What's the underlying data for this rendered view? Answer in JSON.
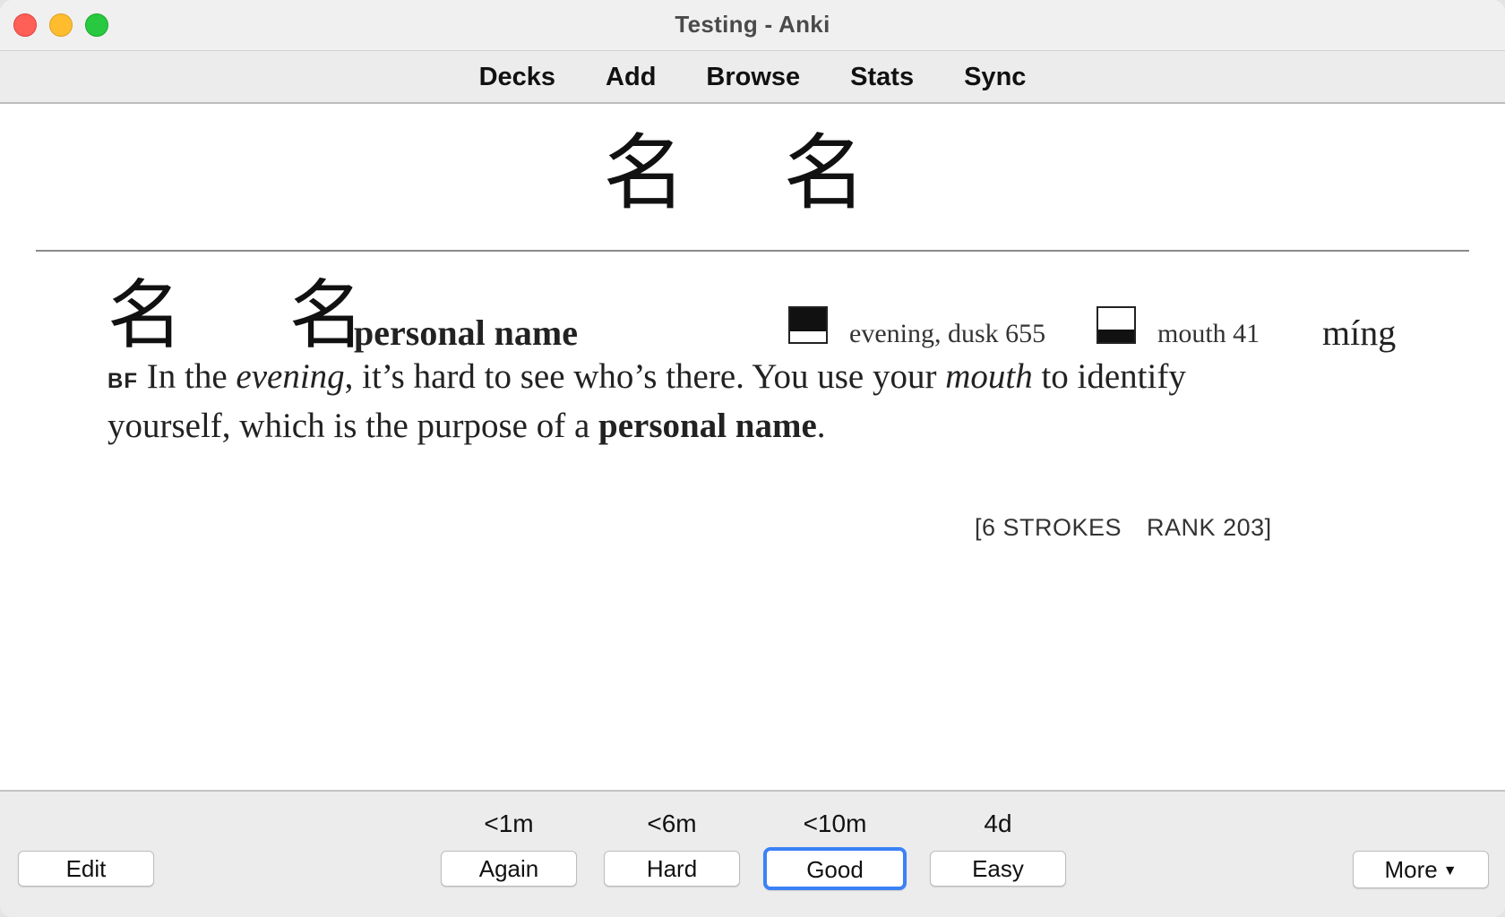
{
  "window": {
    "title": "Testing - Anki"
  },
  "toolbar": {
    "items": [
      {
        "label": "Decks"
      },
      {
        "label": "Add"
      },
      {
        "label": "Browse"
      },
      {
        "label": "Stats"
      },
      {
        "label": "Sync"
      }
    ]
  },
  "card": {
    "front": "名 名",
    "back": {
      "kanji": "名 名",
      "keyword": "personal name",
      "components": [
        {
          "label": "evening, dusk 655",
          "icon": "top-filled-square-icon"
        },
        {
          "label": "mouth 41",
          "icon": "bottom-filled-square-icon"
        }
      ],
      "pinyin": "míng",
      "story": {
        "tag": "BF",
        "part1": " In the ",
        "em1": "evening",
        "part2": ", it’s hard to see who’s there. You use your ",
        "em2": "mouth",
        "part3": " to identify yourself, which is the purpose of a ",
        "strong": "personal name",
        "part4": "."
      },
      "strokes": "[6 STROKES",
      "rank": "RANK 203]"
    }
  },
  "answer_bar": {
    "edit_label": "Edit",
    "more_label": "More",
    "buttons": [
      {
        "interval": "<1m",
        "label": "Again"
      },
      {
        "interval": "<6m",
        "label": "Hard"
      },
      {
        "interval": "<10m",
        "label": "Good"
      },
      {
        "interval": "4d",
        "label": "Easy"
      }
    ],
    "focused_color": "#3b82f6"
  }
}
